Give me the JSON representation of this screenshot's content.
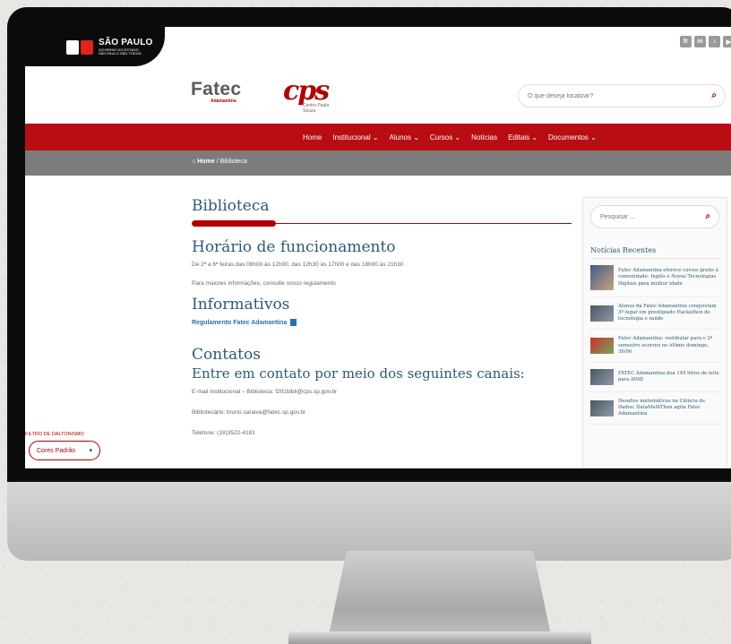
{
  "topbar": {
    "state_name": "SÃO PAULO",
    "state_sub1": "GOVERNO DO ESTADO",
    "state_sub2": "SÃO PAULO SÃO TODOS",
    "social": [
      "fr",
      "in",
      "♪",
      "▶"
    ]
  },
  "header": {
    "brand": "Fatec",
    "brand_sub": "Adamantina",
    "cps_mark": "cps",
    "cps_sub": "Centro Paula Souza",
    "search_placeholder": "O que deseja localizar?"
  },
  "nav": {
    "items": [
      "Home",
      "Institucional ⌄",
      "Alunos ⌄",
      "Cursos ⌄",
      "Notícias",
      "Editais ⌄",
      "Documentos ⌄"
    ]
  },
  "breadcrumb": {
    "home": "Home",
    "current": " / Biblioteca"
  },
  "main": {
    "title": "Biblioteca",
    "horario_title": "Horário de funcionamento",
    "horario_text": "De 2ª a 6ª feiras das 08h00 às 12h00, das 12h30 às 17h00 e das 18h00 às 21h30",
    "mais_info": "Para maiores informações, consulte nosso regulamento",
    "informativos_title": "Informativos",
    "regulamento_link": "Regulamento Fatec Adamantina",
    "contatos_title": "Contatos",
    "contatos_sub": "Entre em contato por meio dos seguintes canais:",
    "email": "E-mail institucional – Biblioteca: f291bibli@cps.sp.gov.br",
    "bibliotecario": "Bibliotecário: bruno.saraiva@fatec.sp.gov.br",
    "telefone": "Telefone: (18)3522-4181"
  },
  "sidebar": {
    "search_placeholder": "Pesquisar ...",
    "recent_title": "Notícias Recentes",
    "news": [
      "Fatec Adamantina oferece cursos gratis à comunidade: Inglês e Novas Tecnologias Digitais para melhor idade",
      "Alunos da Fatec Adamantina conquistam 3º lugar em prestigiado Hackathon de tecnologia e saúde",
      "Fatec Adamantina: vestibular para o 2º semestre ocorreu no último domingo, 30/06",
      "FATEC Adamantina doa 145 litros de leite para APAE",
      "Desafios matemáticos na Ciência de Dados: DataMathThon agita Fatec Adamantina"
    ]
  },
  "filter": {
    "label": "FILTRO DE DALTONISMO",
    "value": "Cores Padrão"
  }
}
